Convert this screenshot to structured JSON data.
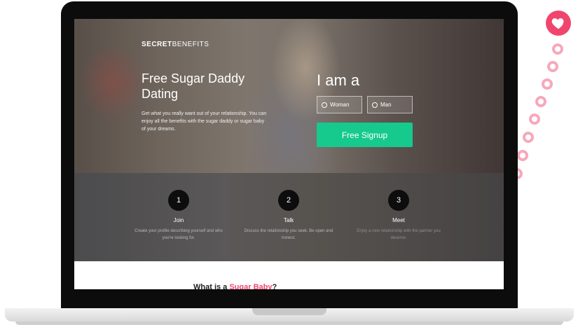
{
  "colors": {
    "accent": "#f0466e",
    "signup": "#16c98d"
  },
  "badge": {
    "icon": "heart-icon"
  },
  "site": {
    "logo_bold": "SECRET",
    "logo_light": "BENEFITS"
  },
  "hero": {
    "title": "Free Sugar Daddy Dating",
    "text": "Get what you really want out of your relationship. You can enjoy all the benefits with the sugar daddy or sugar baby of your dreams."
  },
  "signup_form": {
    "heading": "I am a",
    "options": [
      "Woman",
      "Man"
    ],
    "button": "Free Signup"
  },
  "steps": [
    {
      "number": "1",
      "title": "Join",
      "desc": "Create your profile describing yourself and who you're looking for."
    },
    {
      "number": "2",
      "title": "Talk",
      "desc": "Discuss the relationship you seek. Be open and honest."
    },
    {
      "number": "3",
      "title": "Meet",
      "desc": "Enjoy a new relationship with the partner you deserve."
    }
  ],
  "lower": {
    "heading_prefix": "What is a ",
    "heading_accent": "Sugar Baby",
    "heading_suffix": "?"
  }
}
